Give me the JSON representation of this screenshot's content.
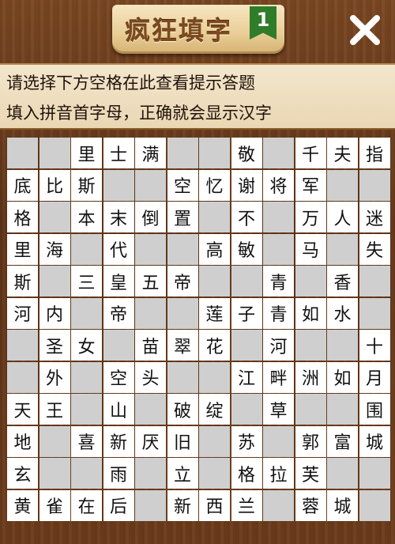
{
  "header": {
    "title": "疯狂填字",
    "level": "1",
    "close_icon": "close-icon"
  },
  "hint": {
    "line1": "请选择下方空格在此查看提示答题",
    "line2": "填入拼音首字母，正确就会显示汉字"
  },
  "grid": [
    [
      "",
      "",
      "里",
      "士",
      "满",
      "",
      "",
      "敬",
      "",
      "千",
      "夫",
      "指"
    ],
    [
      "底",
      "比",
      "斯",
      "",
      "",
      "空",
      "忆",
      "谢",
      "将",
      "军",
      "",
      ""
    ],
    [
      "格",
      "",
      "本",
      "末",
      "倒",
      "置",
      "",
      "不",
      "",
      "万",
      "人",
      "迷"
    ],
    [
      "里",
      "海",
      "",
      "代",
      "",
      "",
      "高",
      "敏",
      "",
      "马",
      "",
      "失"
    ],
    [
      "斯",
      "",
      "三",
      "皇",
      "五",
      "帝",
      "",
      "",
      "青",
      "",
      "香",
      ""
    ],
    [
      "河",
      "内",
      "",
      "帝",
      "",
      "",
      "莲",
      "子",
      "青",
      "如",
      "水",
      ""
    ],
    [
      "",
      "圣",
      "女",
      "",
      "苗",
      "翠",
      "花",
      "",
      "河",
      "",
      "",
      "十"
    ],
    [
      "",
      "外",
      "",
      "空",
      "头",
      "",
      "",
      "江",
      "畔",
      "洲",
      "如",
      "月"
    ],
    [
      "天",
      "王",
      "",
      "山",
      "",
      "破",
      "绽",
      "",
      "草",
      "",
      "",
      "围"
    ],
    [
      "地",
      "",
      "喜",
      "新",
      "厌",
      "旧",
      "",
      "苏",
      "",
      "郭",
      "富",
      "城"
    ],
    [
      "玄",
      "",
      "",
      "雨",
      "",
      "立",
      "",
      "格",
      "拉",
      "芙",
      "",
      ""
    ],
    [
      "黄",
      "雀",
      "在",
      "后",
      "",
      "新",
      "西",
      "兰",
      "",
      "蓉",
      "城",
      ""
    ]
  ]
}
